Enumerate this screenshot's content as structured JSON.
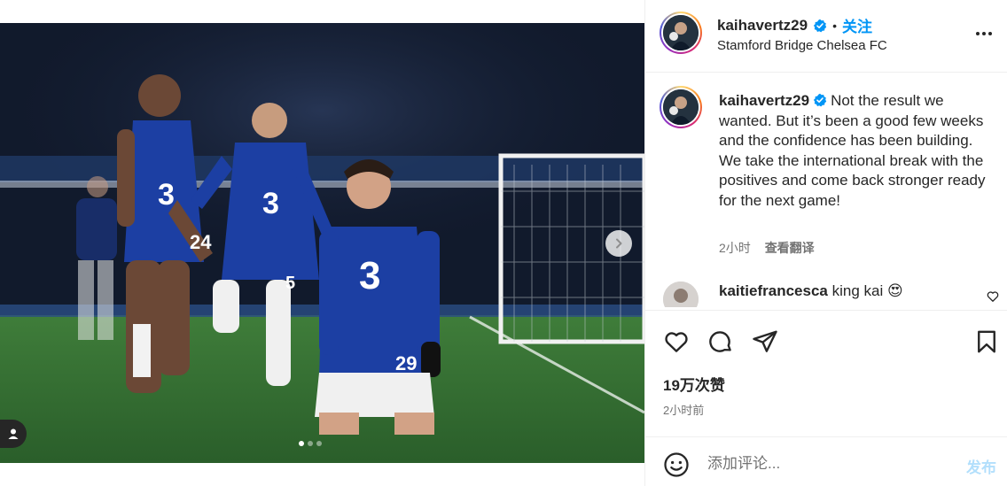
{
  "post": {
    "username": "kaihavertz29",
    "follow_label": "关注",
    "bullet": "•",
    "location": "Stamford Bridge Chelsea FC",
    "more_icon": "more-horizontal-icon"
  },
  "media": {
    "current_slide": 1,
    "total_slides": 3,
    "next_icon": "chevron-right-icon",
    "tag_icon": "user-tag-icon",
    "jersey_numbers": [
      "29",
      "5",
      "24"
    ]
  },
  "caption": {
    "username": "kaihavertz29",
    "text": "Not the result we wanted. But it’s been a good few weeks and the confidence has been building. We take the international break with the positives and come back stronger ready for the next game!",
    "time": "2小时",
    "translate_label": "查看翻译"
  },
  "comment": {
    "username": "kaitiefrancesca",
    "text": "king kai",
    "emoji": "😍"
  },
  "actions": {
    "likes": "19万次赞",
    "time": "2小时前"
  },
  "add_comment": {
    "placeholder": "添加评论...",
    "post_label": "发布"
  },
  "colors": {
    "accent": "#0095f6",
    "post_disabled": "#b2dffc",
    "muted_text": "#737373",
    "divider": "#efefef"
  }
}
